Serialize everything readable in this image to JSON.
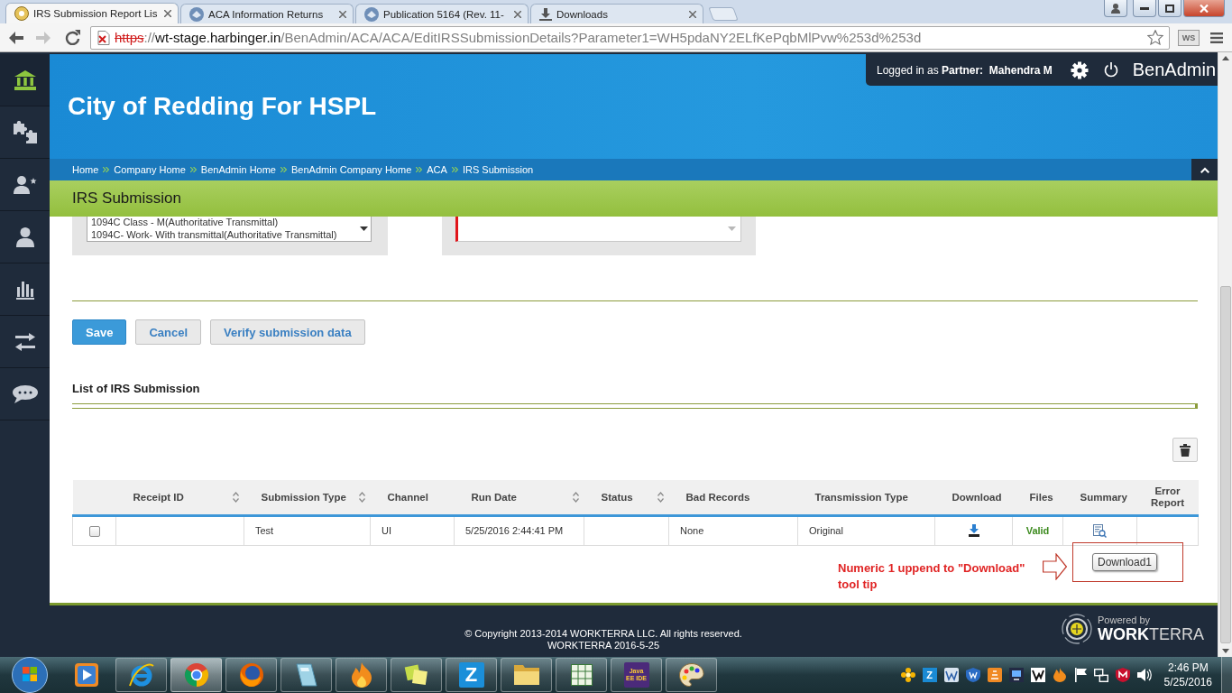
{
  "browser": {
    "tabs": [
      {
        "label": "IRS Submission Report Lis",
        "kind": "page",
        "selected": true
      },
      {
        "label": "ACA Information Returns",
        "kind": "seal",
        "selected": false
      },
      {
        "label": "Publication 5164 (Rev. 11-",
        "kind": "seal",
        "selected": false
      },
      {
        "label": "Downloads",
        "kind": "download",
        "selected": false
      }
    ],
    "forward_disabled": true,
    "address": {
      "scheme": "https",
      "separator": "://",
      "host": "wt-stage.harbinger.in",
      "path": "/BenAdmin/ACA/ACA/EditIRSSubmissionDetails?Parameter1=WH5pdaNY2ELfKePqbMlPvw%253d%253d"
    },
    "extension": "WS"
  },
  "sidebar": {
    "items": [
      {
        "selected": true
      },
      {
        "selected": false
      },
      {
        "selected": false
      },
      {
        "selected": false
      },
      {
        "selected": false
      },
      {
        "selected": false
      },
      {
        "selected": false
      }
    ]
  },
  "header": {
    "user": "Logged in as **Partner:**  **Mahendra M**",
    "app_name": "BenAdmin",
    "title": "City of Redding For HSPL",
    "breadcrumbs": [
      "Home",
      "Company Home",
      "BenAdmin Home",
      "BenAdmin Company Home",
      "ACA",
      "IRS Submission"
    ]
  },
  "section_title": "IRS Submission",
  "form": {
    "listbox": {
      "options": [
        "1094C Class - M(Authoritative Transmittal)",
        "1094C- Work- With transmittal(Authoritative Transmittal)"
      ]
    },
    "second_field": {
      "required": true
    }
  },
  "buttons": [
    {
      "label": "Save",
      "kind": "primary"
    },
    {
      "label": "Cancel",
      "kind": "secondary"
    },
    {
      "label": "Verify submission data",
      "kind": "secondary"
    }
  ],
  "list_title": "List of IRS Submission",
  "table": {
    "columns": [
      {
        "label": "Receipt ID",
        "sortable": true
      },
      {
        "label": "Submission Type",
        "sortable": true
      },
      {
        "label": "Channel",
        "sortable": false
      },
      {
        "label": "Run Date",
        "sortable": true
      },
      {
        "label": "Status",
        "sortable": true
      },
      {
        "label": "Bad Records",
        "sortable": false
      },
      {
        "label": "Transmission Type",
        "sortable": false
      },
      {
        "label": "Download",
        "sortable": false
      },
      {
        "label": "Files",
        "sortable": false
      },
      {
        "label": "Summary",
        "sortable": false
      },
      {
        "label": "Error Report",
        "sortable": false
      }
    ],
    "rows": [
      {
        "checked": false,
        "submission_type": "Test",
        "channel": "UI",
        "run_date": "5/25/2016 2:44:41 PM",
        "bad_records": "None",
        "transmission_type": "Original",
        "files": "Valid"
      }
    ]
  },
  "annotation": {
    "note": "Numeric 1 uppend to \"Download\" tool tip",
    "tooltip": "Download1"
  },
  "footer": {
    "copyright": "© Copyright 2013-2014 WORKTERRA LLC. All rights reserved.",
    "version": "WORKTERRA 2016-5-25",
    "powered_by": "Powered by",
    "brand": "**WORK**TERRA"
  },
  "taskbar": {
    "apps": [
      {
        "running": false,
        "selected": false
      },
      {
        "running": true,
        "selected": false
      },
      {
        "running": true,
        "selected": true
      },
      {
        "running": true,
        "selected": false
      },
      {
        "running": true,
        "selected": false
      },
      {
        "running": true,
        "selected": false
      },
      {
        "running": true,
        "selected": false
      },
      {
        "running": true,
        "selected": false,
        "label": "Z"
      },
      {
        "running": true,
        "selected": false
      },
      {
        "running": true,
        "selected": false
      },
      {
        "running": true,
        "selected": false,
        "label": "Java EE IDE"
      },
      {
        "running": true,
        "selected": false
      }
    ],
    "tray_letter": "Z",
    "time": "2:46 PM",
    "date": "5/25/2016"
  }
}
